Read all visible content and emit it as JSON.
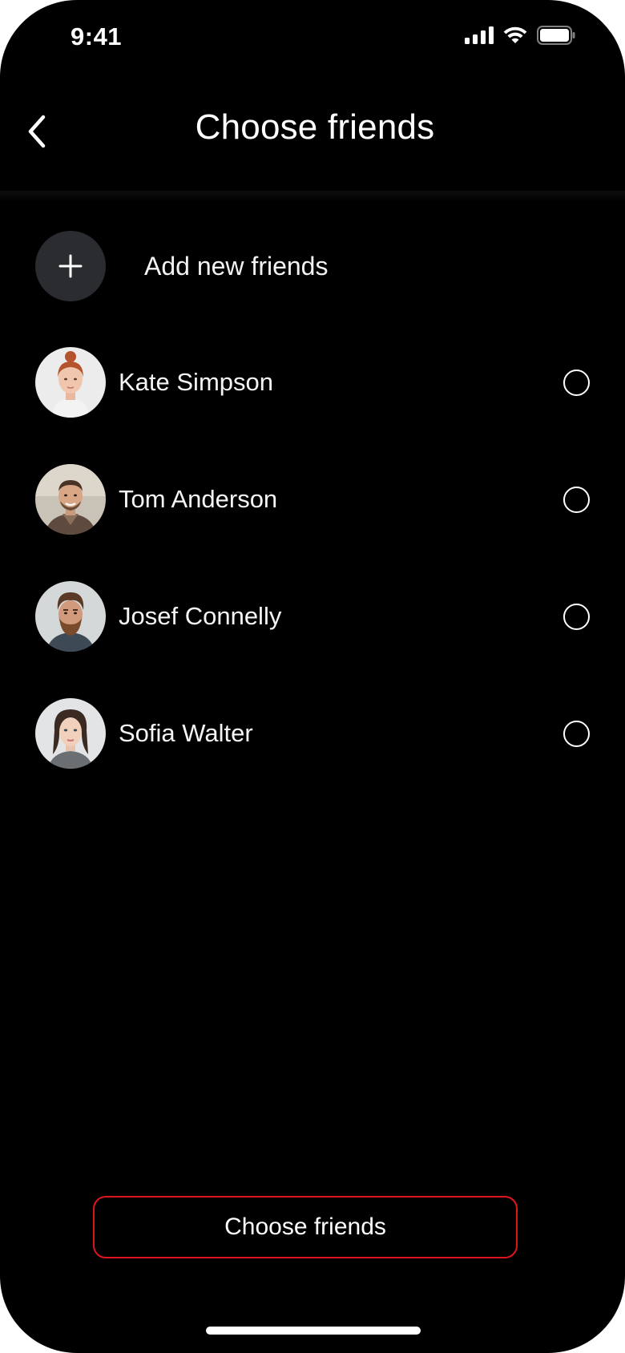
{
  "status_bar": {
    "time": "9:41",
    "icons": [
      "cellular-signal-icon",
      "wifi-icon",
      "battery-icon"
    ]
  },
  "header": {
    "back_icon": "chevron-left-icon",
    "title": "Choose friends"
  },
  "add_friends": {
    "icon": "plus-icon",
    "label": "Add new friends"
  },
  "friends": [
    {
      "name": "Kate Simpson",
      "avatar": "avatar-photo",
      "selected": false
    },
    {
      "name": "Tom Anderson",
      "avatar": "avatar-photo",
      "selected": false
    },
    {
      "name": "Josef Connelly",
      "avatar": "avatar-photo",
      "selected": false
    },
    {
      "name": "Sofia Walter",
      "avatar": "avatar-photo",
      "selected": false
    }
  ],
  "primary_button": {
    "label": "Choose friends"
  },
  "colors": {
    "background": "#000000",
    "button_border": "#e0141e",
    "add_circle": "#2a2c2f",
    "text": "#ffffff"
  }
}
